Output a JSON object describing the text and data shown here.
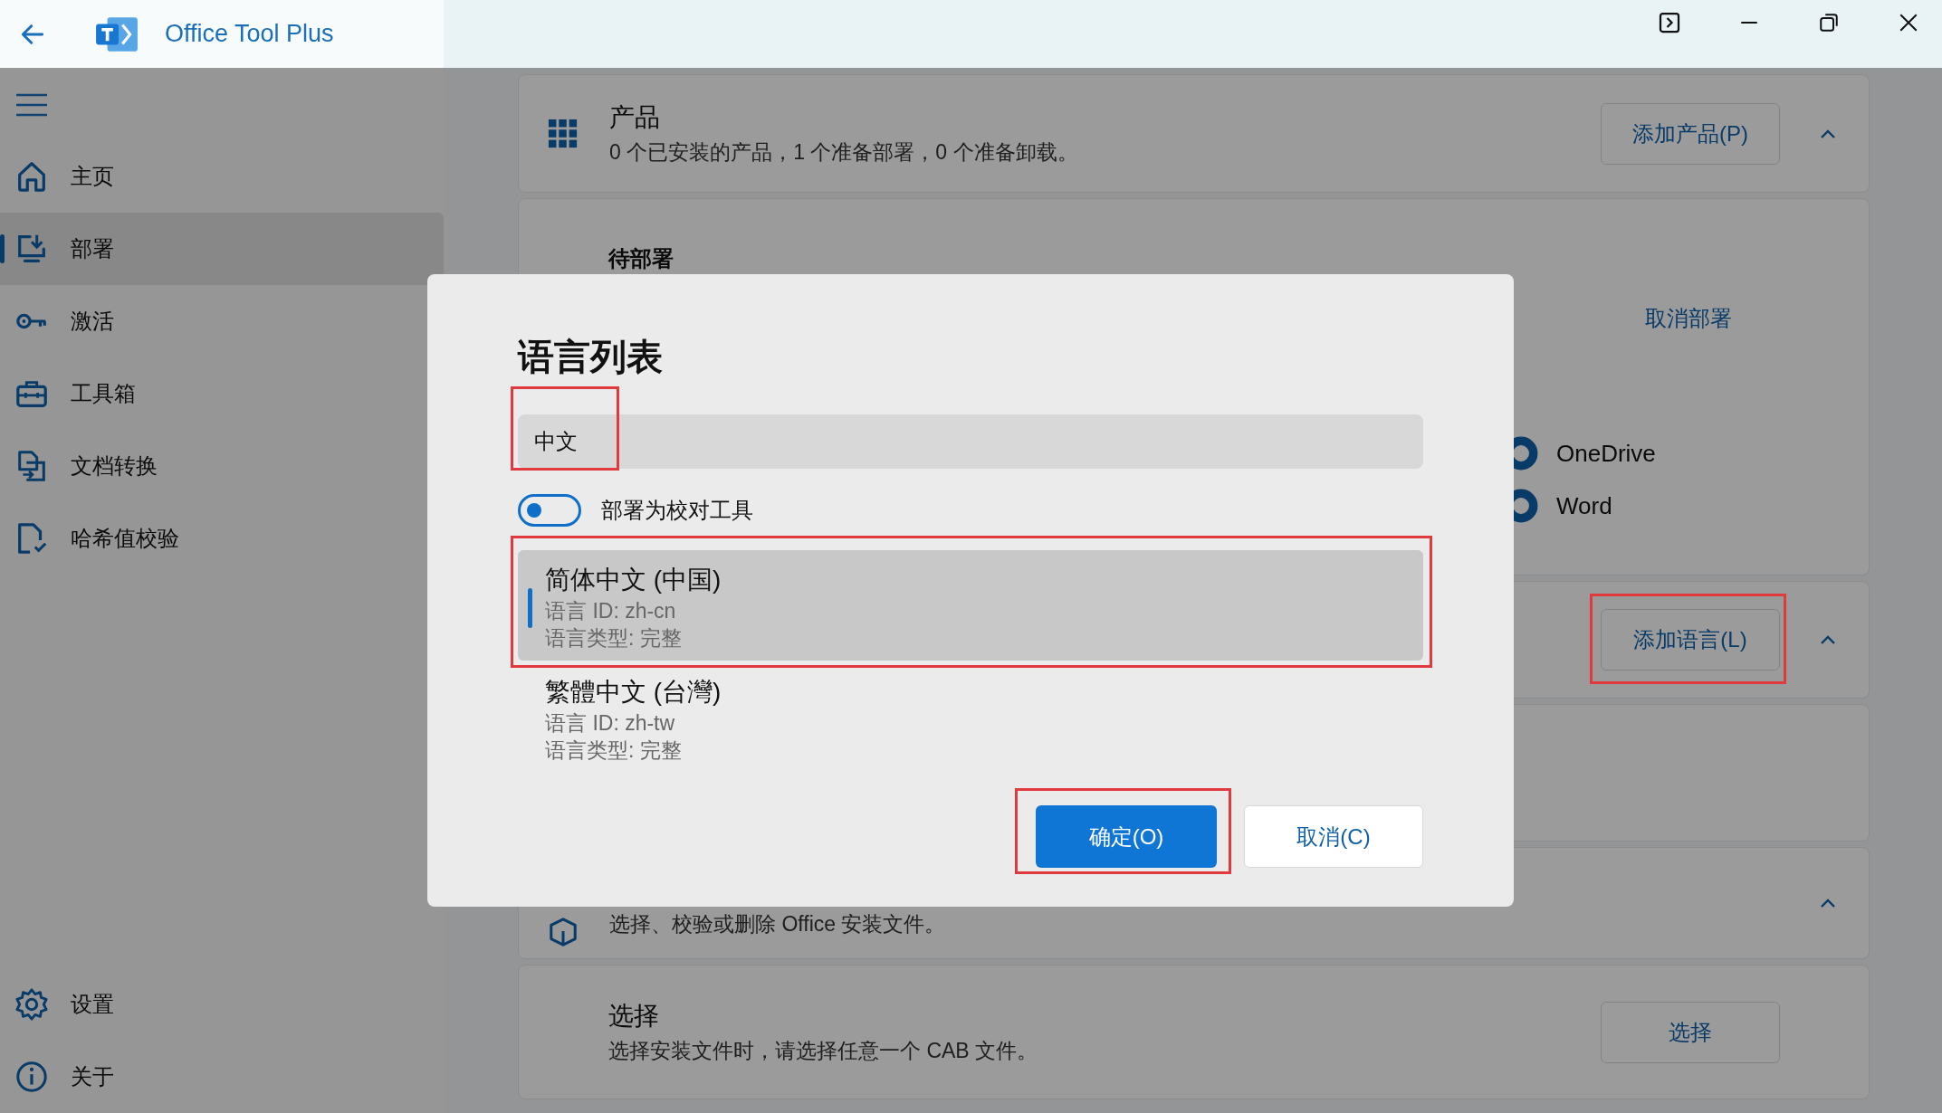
{
  "window": {
    "title": "Office Tool Plus"
  },
  "sidebar": {
    "items": [
      {
        "label": "主页",
        "selected": false
      },
      {
        "label": "部署",
        "selected": true
      },
      {
        "label": "激活",
        "selected": false
      },
      {
        "label": "工具箱",
        "selected": false
      },
      {
        "label": "文档转换",
        "selected": false
      },
      {
        "label": "哈希值校验",
        "selected": false
      }
    ],
    "footer_items": [
      {
        "label": "设置"
      },
      {
        "label": "关于"
      }
    ]
  },
  "products": {
    "title": "产品",
    "description": "0 个已安装的产品，1 个准备部署，0 个准备卸载。",
    "button": "添加产品(P)",
    "expanded": true
  },
  "pending": {
    "title": "待部署",
    "cancel_button": "取消部署",
    "apps": [
      {
        "name": "OneDrive"
      },
      {
        "name": "Word"
      }
    ]
  },
  "languages": {
    "button": "添加语言(L)",
    "expanded": true
  },
  "install_files": {
    "description": "选择、校验或删除 Office 安装文件。",
    "expanded": true
  },
  "select": {
    "title": "选择",
    "description": "选择安装文件时，请选择任意一个 CAB 文件。",
    "button": "选择"
  },
  "dialog": {
    "title": "语言列表",
    "search": {
      "value": "中文"
    },
    "proofing_toggle": {
      "label": "部署为校对工具",
      "on": false
    },
    "languages": [
      {
        "name": "简体中文 (中国)",
        "id": "语言 ID: zh-cn",
        "type": "语言类型: 完整",
        "selected": true
      },
      {
        "name": "繁體中文 (台灣)",
        "id": "语言 ID: zh-tw",
        "type": "语言类型: 完整",
        "selected": false
      }
    ],
    "ok_button": "确定(O)",
    "cancel_button": "取消(C)"
  }
}
